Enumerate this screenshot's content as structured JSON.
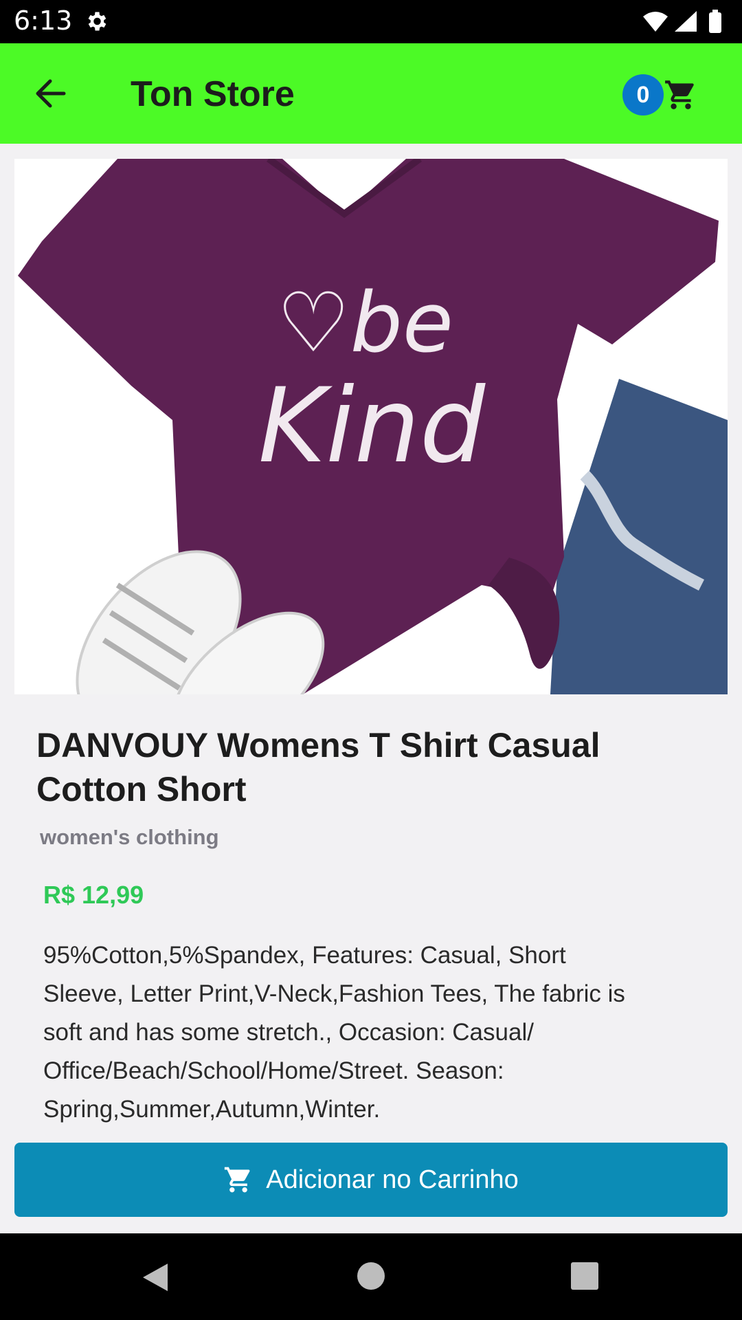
{
  "status_bar": {
    "time": "6:13"
  },
  "app_bar": {
    "title": "Ton Store",
    "cart_count": "0"
  },
  "product": {
    "image_text": "be kind",
    "title": "DANVOUY Womens T Shirt Casual Cotton Short",
    "category": "women's clothing",
    "price": "R$ 12,99",
    "description": "95%Cotton,5%Spandex, Features: Casual, Short Sleeve, Letter Print,V-Neck,Fashion Tees, The fabric is soft and has some stretch., Occasion: Casual/ Office/Beach/School/Home/Street. Season: Spring,Summer,Autumn,Winter."
  },
  "actions": {
    "add_to_cart_label": "Adicionar no Carrinho"
  },
  "colors": {
    "app_bar": "#4cfa26",
    "badge": "#0a77c9",
    "price": "#2fc957",
    "button": "#0c8cb6"
  },
  "icons": {
    "back": "arrow-left-icon",
    "cart": "shopping-cart-icon",
    "settings": "gear-icon"
  }
}
